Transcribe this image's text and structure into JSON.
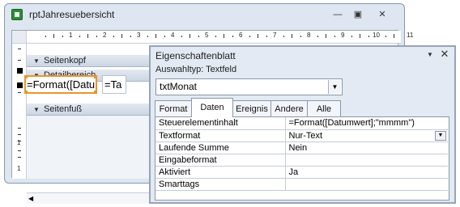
{
  "report": {
    "title": "rptJahresuebersicht",
    "icons": {
      "app": "access-report-icon",
      "minimize": "minimize-icon",
      "restore": "restore-icon",
      "close": "close-icon"
    },
    "ruler_numbers": [
      "1",
      "2",
      "3",
      "4",
      "5",
      "6",
      "7",
      "8",
      "9",
      "10",
      "11"
    ],
    "vruler_numbers": [
      "1",
      "1"
    ],
    "sections": {
      "header": "Seitenkopf",
      "detail": "Detailbereich",
      "footer": "Seitenfuß"
    },
    "controls": {
      "textbox": "=Format([Datu",
      "label": "=Ta"
    }
  },
  "property_sheet": {
    "title": "Eigenschaftenblatt",
    "selection_type": "Auswahltyp:  Textfeld",
    "selected_object": "txtMonat",
    "tabs": [
      {
        "label": "Format",
        "active": false
      },
      {
        "label": "Daten",
        "active": true
      },
      {
        "label": "Ereignis",
        "active": false
      },
      {
        "label": "Andere",
        "active": false
      },
      {
        "label": "Alle",
        "active": false
      }
    ],
    "rows": [
      {
        "name": "Steuerelementinhalt",
        "value": "=Format([Datumwert];\"mmmm\")"
      },
      {
        "name": "Textformat",
        "value": "Nur-Text"
      },
      {
        "name": "Laufende Summe",
        "value": "Nein"
      },
      {
        "name": "Eingabeformat",
        "value": ""
      },
      {
        "name": "Aktiviert",
        "value": "Ja"
      },
      {
        "name": "Smarttags",
        "value": ""
      }
    ]
  },
  "colors": {
    "accent_selection": "#e8962a",
    "window_bg": "#dde6f1",
    "section_bar": "#ccd6e3"
  }
}
